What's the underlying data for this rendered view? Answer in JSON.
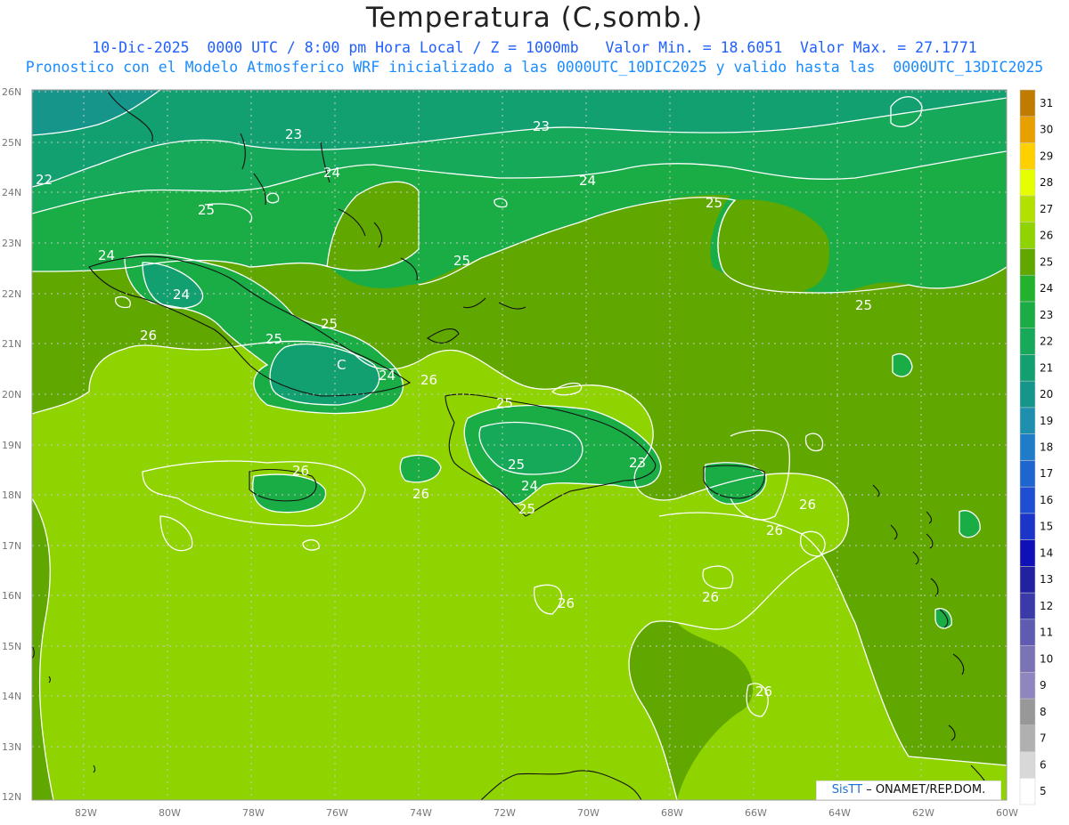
{
  "title": "Temperatura (C,somb.)",
  "subtitle_line1": "10-Dic-2025  0000 UTC / 8:00 pm Hora Local / Z = 1000mb   Valor Min. = 18.6051  Valor Max. = 27.1771",
  "subtitle_line2": "Pronostico con el Modelo Atmosferico WRF inicializado a las 0000UTC_10DIC2025 y valido hasta las  0000UTC_13DIC2025",
  "lat_labels": [
    "26N",
    "25N",
    "24N",
    "23N",
    "22N",
    "21N",
    "20N",
    "19N",
    "18N",
    "17N",
    "16N",
    "15N",
    "14N",
    "13N",
    "12N"
  ],
  "lon_labels": [
    "82W",
    "80W",
    "78W",
    "76W",
    "74W",
    "72W",
    "70W",
    "68W",
    "66W",
    "64W",
    "62W",
    "60W"
  ],
  "colorbar": {
    "levels": [
      "5",
      "6",
      "7",
      "8",
      "9",
      "10",
      "11",
      "12",
      "13",
      "14",
      "15",
      "16",
      "17",
      "18",
      "19",
      "20",
      "21",
      "22",
      "23",
      "24",
      "25",
      "26",
      "27",
      "28",
      "29",
      "30",
      "31"
    ],
    "colors": [
      "#ffffff",
      "#d8d8d8",
      "#b0b0b0",
      "#989898",
      "#8f85bf",
      "#7a74b6",
      "#5f5bb0",
      "#3a3aa8",
      "#2222a0",
      "#1010b8",
      "#1a35c8",
      "#1e4fd2",
      "#1f65d0",
      "#1f7cc8",
      "#1f8fb0",
      "#16958a",
      "#12a070",
      "#16a95a",
      "#1aad45",
      "#23b12e",
      "#60a800",
      "#8fd400",
      "#b4e000",
      "#e6ff00",
      "#ffd000",
      "#e8a000",
      "#c07c00"
    ]
  },
  "contour_labels": [
    "23",
    "23",
    "22",
    "24",
    "24",
    "24",
    "24",
    "25",
    "25",
    "25",
    "25",
    "25",
    "25",
    "26",
    "26",
    "26",
    "26",
    "26",
    "26",
    "26",
    "26",
    "26",
    "25",
    "24",
    "25",
    "23",
    "24",
    "25",
    "C"
  ],
  "credit": {
    "brand": "SisTT",
    "text": " – ONAMET/REP.DOM."
  }
}
